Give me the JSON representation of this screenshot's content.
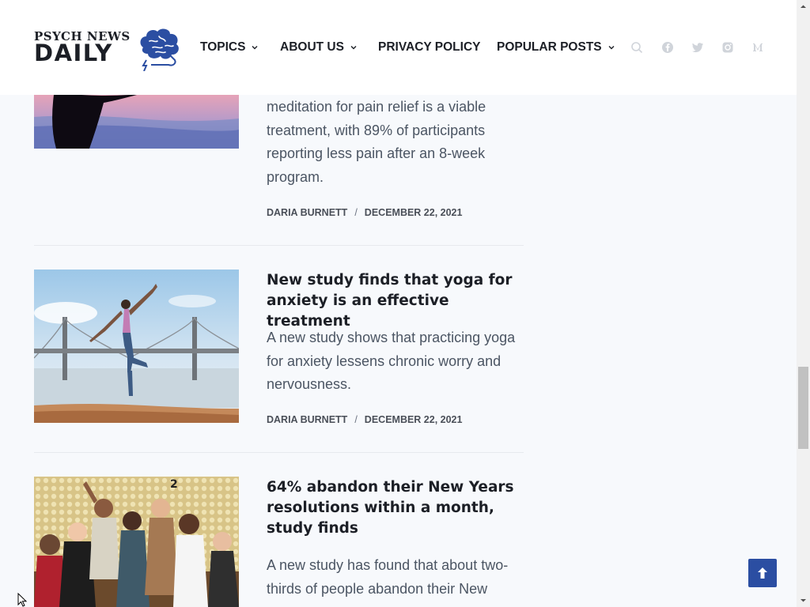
{
  "header": {
    "logo_line1": "PSYCH NEWS",
    "logo_line2": "DAILY",
    "nav": [
      {
        "label": "TOPICS",
        "dropdown": true
      },
      {
        "label": "ABOUT US",
        "dropdown": true
      },
      {
        "label": "PRIVACY POLICY",
        "dropdown": false
      },
      {
        "label": "POPULAR POSTS",
        "dropdown": true
      }
    ],
    "icons": [
      "search-icon",
      "facebook-icon",
      "twitter-icon",
      "instagram-icon",
      "medium-icon"
    ]
  },
  "articles": [
    {
      "excerpt": "meditation for pain relief is a viable treatment, with 89% of participants reporting less pain after an 8-week program.",
      "author": "DARIA BURNETT",
      "separator": "/",
      "date": "DECEMBER 22, 2021"
    },
    {
      "title": "New study finds that yoga for anxiety is an effective treatment",
      "excerpt": "A new study shows that practicing yoga for anxiety lessens chronic worry and nervousness.",
      "author": "DARIA BURNETT",
      "separator": "/",
      "date": "DECEMBER 22, 2021"
    },
    {
      "title": "64% abandon their New Years resolutions within a month, study finds",
      "excerpt": "A new study has found that about two-thirds of people abandon their New"
    }
  ],
  "colors": {
    "brand_blue": "#2b4ea2",
    "page_bg": "#f7f9fc",
    "heading": "#1c1f26",
    "body_text": "#4b5563"
  }
}
